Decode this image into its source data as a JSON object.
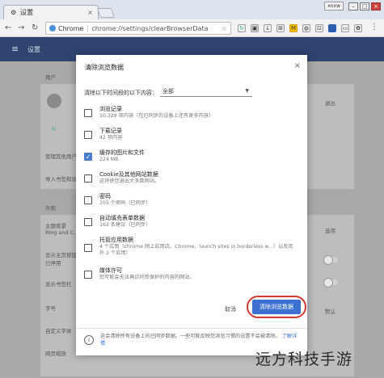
{
  "browser": {
    "tab_title": "设置",
    "tab_close": "×",
    "user": "xnxw",
    "url_security": "Chrome",
    "url_path": "chrome://settings/clearBrowserData"
  },
  "settings": {
    "title": "设置",
    "bg_labels": {
      "people": "用户",
      "manage": "管理其他用户",
      "import": "导入书签和设置",
      "appearance": "外观",
      "theme": "主题背景",
      "theme_sub": "Blog and C...",
      "show_home": "显示主页按钮",
      "show_home_sub": "已停用",
      "show_bookmarks": "显示书签栏",
      "font_size": "字号",
      "custom_fonts": "自定义字体",
      "zoom": "网页缩放",
      "signout": "退出",
      "option_label": "选项",
      "default_label": "默认"
    }
  },
  "dialog": {
    "title": "清除浏览数据",
    "close": "×",
    "range_label": "清除以下时间段的以下内容：",
    "range_value": "全部",
    "options": [
      {
        "label": "浏览记录",
        "desc": "10,329 项内容（在已同步的设备上还有更多内容）",
        "checked": false
      },
      {
        "label": "下载记录",
        "desc": "42 项内容",
        "checked": false
      },
      {
        "label": "缓存的图片和文件",
        "desc": "224 MB",
        "checked": true
      },
      {
        "label": "Cookie及其他网站数据",
        "desc": "这将使您退出大多数网站。",
        "checked": false
      },
      {
        "label": "密码",
        "desc": "105 个密码（已同步）",
        "checked": false
      },
      {
        "label": "自动填充表单数据",
        "desc": "162 条建议（已同步）",
        "checked": false
      },
      {
        "label": "托管应用数据",
        "desc": "4 个应用（chrome 网上应用店、Chrome、launch sites in borderless w...）以及另外 2 个应用）",
        "checked": false
      },
      {
        "label": "媒体许可",
        "desc": "您可能会无法再访问受保护的内容的网站。",
        "checked": false
      }
    ],
    "cancel": "取消",
    "clear": "清除浏览数据",
    "note": "这会清除所有设备上的已同步数据。一些可能反映您浏览习惯的设置不会被清除。",
    "note_link": "了解详情",
    "info_icon": "i"
  },
  "watermark": "远方科技手游"
}
